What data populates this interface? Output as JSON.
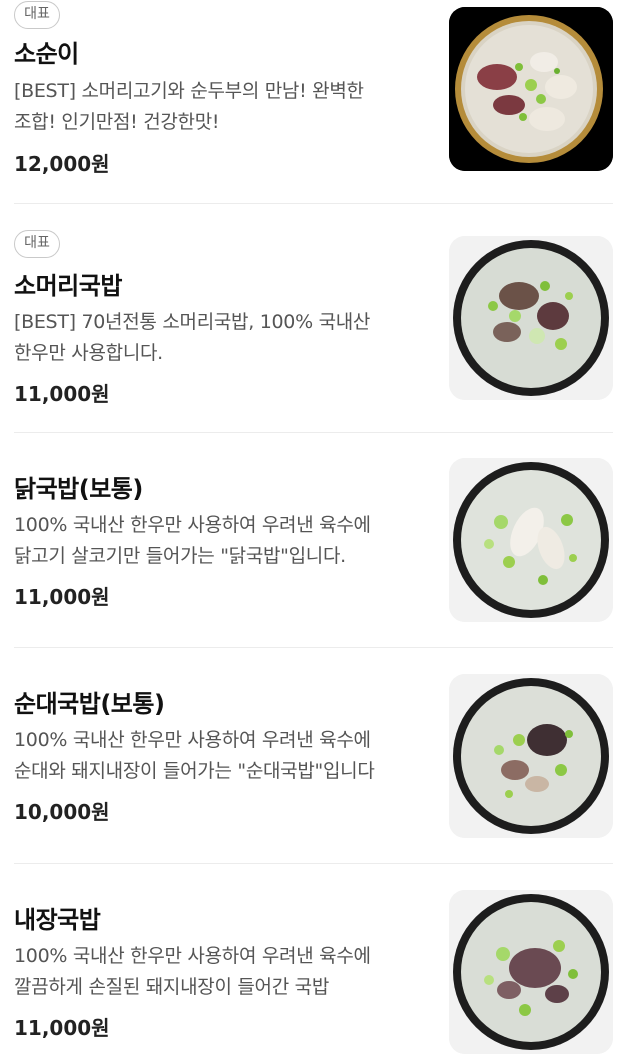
{
  "menu": {
    "items": [
      {
        "badge": "대표",
        "name": "소순이",
        "desc_lines": [
          "[BEST] 소머리고기와 순두부의 만남! 완벽한",
          "조합! 인기만점! 건강한맛!"
        ],
        "price": "12,000원",
        "image_icon": "soup-bowl-brass-icon",
        "bg_color": "#000000"
      },
      {
        "badge": "대표",
        "name": "소머리국밥",
        "desc_lines": [
          "[BEST] 70년전통 소머리국밥, 100% 국내산",
          "한우만 사용합니다."
        ],
        "price": "11,000원",
        "image_icon": "soup-bowl-icon",
        "bg_color": "#f2f2f2"
      },
      {
        "name": "닭국밥(보통)",
        "desc_lines": [
          "100% 국내산 한우만 사용하여 우려낸 육수에",
          "닭고기 살코기만 들어가는 \"닭국밥\"입니다."
        ],
        "price": "11,000원",
        "image_icon": "soup-bowl-icon",
        "bg_color": "#f2f2f2"
      },
      {
        "name": "순대국밥(보통)",
        "desc_lines": [
          "100% 국내산 한우만 사용하여 우려낸 육수에",
          "순대와 돼지내장이 들어가는 \"순대국밥\"입니다"
        ],
        "price": "10,000원",
        "image_icon": "soup-bowl-icon",
        "bg_color": "#f2f2f2"
      },
      {
        "name": "내장국밥",
        "desc_lines": [
          "100% 국내산 한우만 사용하여 우려낸 육수에",
          "깔끔하게 손질된 돼지내장이 들어간 국밥"
        ],
        "price": "11,000원",
        "image_icon": "soup-bowl-icon",
        "bg_color": "#f2f2f2"
      }
    ]
  }
}
